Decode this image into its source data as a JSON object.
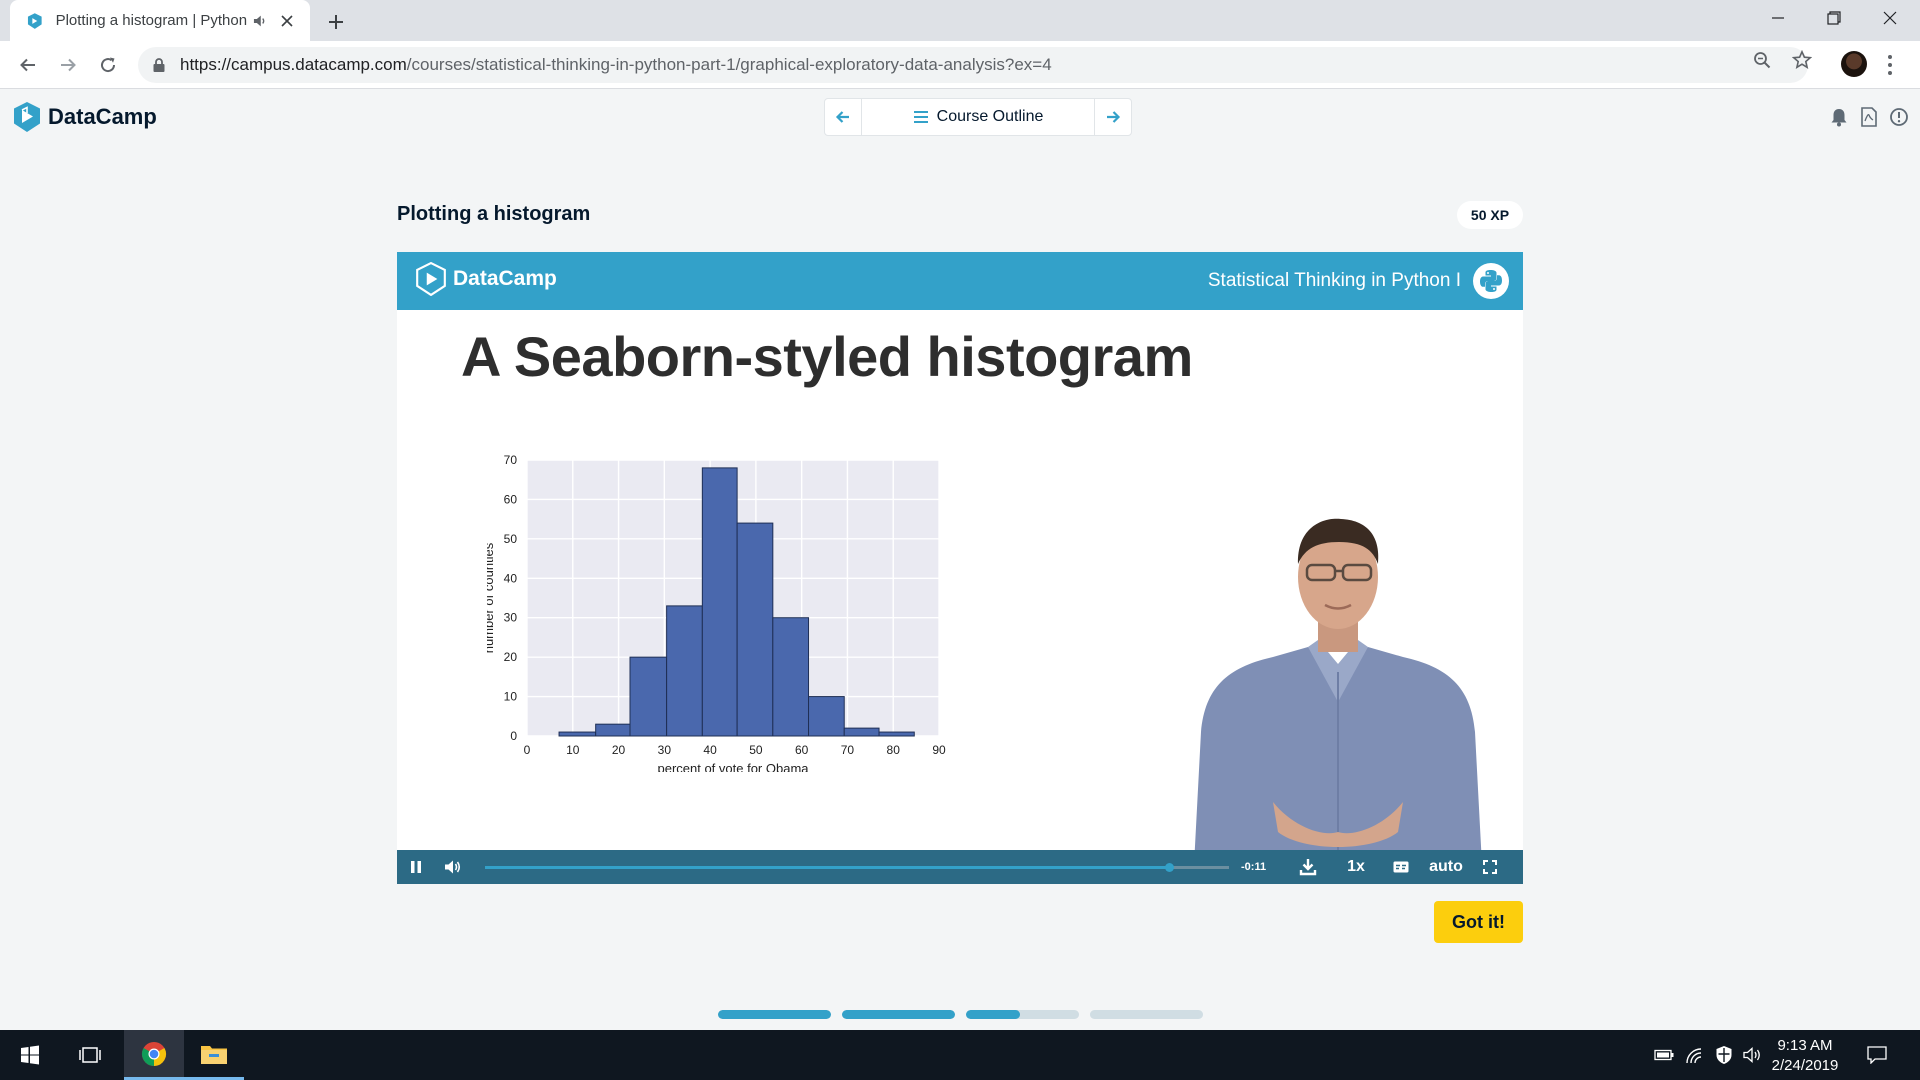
{
  "browser": {
    "tab_title": "Plotting a histogram | Python",
    "url_host": "https://campus.datacamp.com",
    "url_path": "/courses/statistical-thinking-in-python-part-1/graphical-exploratory-data-analysis?ex=4"
  },
  "header": {
    "logo_text": "DataCamp",
    "course_outline_label": "Course Outline"
  },
  "exercise": {
    "title": "Plotting a histogram",
    "xp": "50 XP",
    "got_it_label": "Got it!",
    "steps_progress": [
      1,
      1,
      0.48,
      0
    ]
  },
  "video": {
    "slide_logo": "DataCamp",
    "course_name": "Statistical Thinking in Python I",
    "slide_heading": "A Seaborn-styled histogram",
    "time_remaining": "-0:11",
    "speed": "1x",
    "quality": "auto",
    "progress": 0.92
  },
  "chart_data": {
    "type": "bar",
    "title": "",
    "xlabel": "percent of vote for Obama",
    "ylabel": "number of counties",
    "xlim": [
      0,
      90
    ],
    "ylim": [
      0,
      70
    ],
    "xticks": [
      0,
      10,
      20,
      30,
      40,
      50,
      60,
      70,
      80,
      90
    ],
    "yticks": [
      0,
      10,
      20,
      30,
      40,
      50,
      60,
      70
    ],
    "bins": [
      {
        "start": 7,
        "end": 15,
        "value": 1
      },
      {
        "start": 15,
        "end": 22.5,
        "value": 3
      },
      {
        "start": 22.5,
        "end": 30.5,
        "value": 20
      },
      {
        "start": 30.5,
        "end": 38.3,
        "value": 33
      },
      {
        "start": 38.3,
        "end": 45.9,
        "value": 68
      },
      {
        "start": 45.9,
        "end": 53.7,
        "value": 54
      },
      {
        "start": 53.7,
        "end": 61.5,
        "value": 30
      },
      {
        "start": 61.5,
        "end": 69.3,
        "value": 10
      },
      {
        "start": 69.3,
        "end": 76.9,
        "value": 2
      },
      {
        "start": 76.9,
        "end": 84.6,
        "value": 1
      }
    ],
    "grid": true,
    "bar_color": "#4a68ad",
    "background_color": "#eaeaf2"
  },
  "taskbar": {
    "time": "9:13 AM",
    "date": "2/24/2019"
  },
  "colors": {
    "brand_blue": "#33a1c9",
    "accent_yellow": "#fcce0d",
    "control_bar": "#2c6a85"
  }
}
